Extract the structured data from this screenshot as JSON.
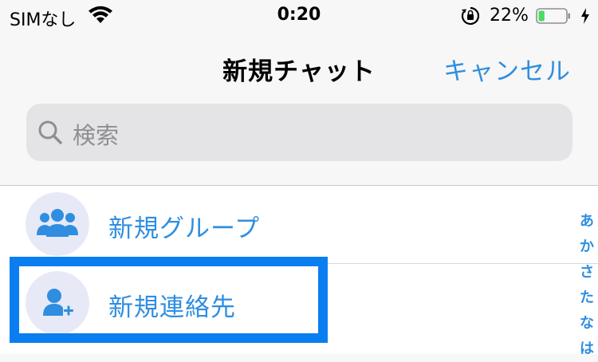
{
  "status_bar": {
    "carrier": "SIMなし",
    "time": "0:20",
    "battery_percent": "22%",
    "battery_level": 0.22,
    "icons": [
      "wifi-icon",
      "orientation-lock-icon",
      "battery-icon",
      "charging-bolt-icon"
    ]
  },
  "nav": {
    "title": "新規チャット",
    "cancel_label": "キャンセル"
  },
  "search": {
    "placeholder": "検索",
    "icon": "search-icon"
  },
  "list": {
    "items": [
      {
        "label": "新規グループ",
        "icon": "group-icon"
      },
      {
        "label": "新規連絡先",
        "icon": "add-contact-icon"
      }
    ]
  },
  "index": {
    "letters": [
      "あ",
      "か",
      "さ",
      "た",
      "な",
      "は"
    ]
  },
  "colors": {
    "accent": "#2f8ee0",
    "highlight": "#0a7ef0",
    "avatar_bg": "#e8e9f7",
    "battery_green": "#4cd964"
  }
}
